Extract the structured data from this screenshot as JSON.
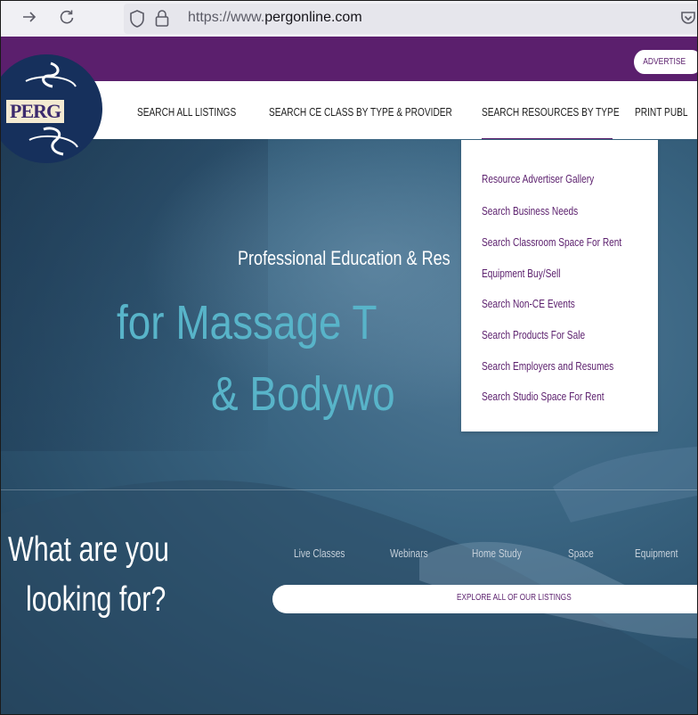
{
  "browser": {
    "url_prefix": "https://www.",
    "url_domain": "pergonline.com"
  },
  "header": {
    "advertise_label": "ADVERTISE",
    "logo_text": "PERG"
  },
  "nav": {
    "items": [
      "SEARCH ALL LISTINGS",
      "SEARCH CE CLASS BY TYPE & PROVIDER",
      "SEARCH RESOURCES BY TYPE",
      "PRINT PUBL"
    ]
  },
  "dropdown": {
    "items": [
      "Resource Advertiser Gallery",
      "Search Business Needs",
      "Search Classroom Space For Rent",
      "Equipment Buy/Sell",
      "Search Non-CE Events",
      "Search Products For Sale",
      "Search Employers and Resumes",
      "Search Studio Space For Rent"
    ]
  },
  "hero": {
    "subtitle": "Professional Education & Res",
    "line1": "for Massage T          s",
    "line2": "& Bodywo"
  },
  "search": {
    "heading_line1": "What are you",
    "heading_line2": "looking for?",
    "categories": [
      "Live Classes",
      "Webinars",
      "Home Study",
      "Space",
      "Equipment"
    ],
    "explore_label": "EXPLORE ALL OF OUR LISTINGS"
  },
  "colors": {
    "brand_purple": "#5b1f6d",
    "hero_teal": "#58b4c9",
    "hero_blue": "#3a6582"
  }
}
